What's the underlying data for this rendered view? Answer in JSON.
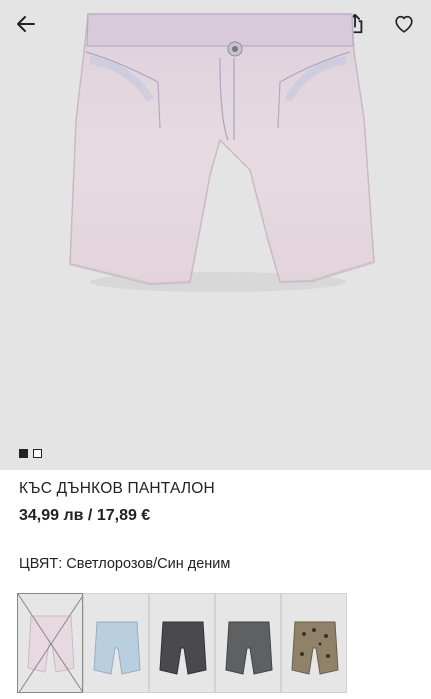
{
  "header": {
    "back_icon": "arrow-left-icon",
    "share_icon": "share-icon",
    "favorite_icon": "heart-icon"
  },
  "gallery": {
    "total_images": 2,
    "active_index": 0
  },
  "product": {
    "title": "КЪС ДЪНКОВ ПАНТАЛОН",
    "price": "34,99 лв / 17,89 €",
    "color_label": "ЦВЯТ: Светлорозов/Син деним"
  },
  "swatches": [
    {
      "color": "#e8d9e0",
      "selected": true,
      "unavailable": true
    },
    {
      "color": "#b9cfe0",
      "selected": false,
      "unavailable": false
    },
    {
      "color": "#4a4a4c",
      "selected": false,
      "unavailable": false
    },
    {
      "color": "#5f6062",
      "selected": false,
      "unavailable": false
    },
    {
      "color": "#8f8268",
      "selected": false,
      "unavailable": false
    }
  ]
}
